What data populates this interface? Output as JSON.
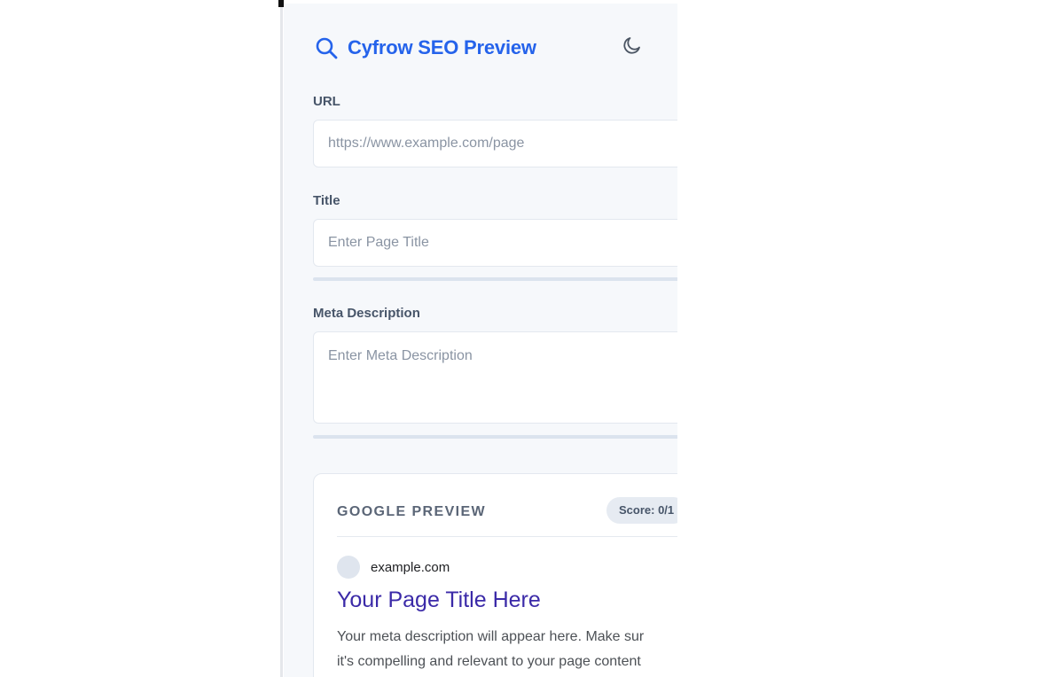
{
  "app": {
    "title": "Cyfrow SEO Preview",
    "accent_color": "#2563eb",
    "logo_icon": "search-icon",
    "theme_toggle_icon": "moon-icon"
  },
  "form": {
    "url": {
      "label": "URL",
      "placeholder": "https://www.example.com/page",
      "value": ""
    },
    "title": {
      "label": "Title",
      "placeholder": "Enter Page Title",
      "value": ""
    },
    "meta_description": {
      "label": "Meta Description",
      "placeholder": "Enter Meta Description",
      "value": ""
    }
  },
  "google_preview": {
    "heading": "GOOGLE PREVIEW",
    "score_label": "Score: 0/1",
    "domain": "example.com",
    "result_title": "Your Page Title Here",
    "result_title_color": "#3b2aa8",
    "snippet_line_1": "Your meta description will appear here. Make sur",
    "snippet_line_2": "it's compelling and relevant to your page content"
  }
}
